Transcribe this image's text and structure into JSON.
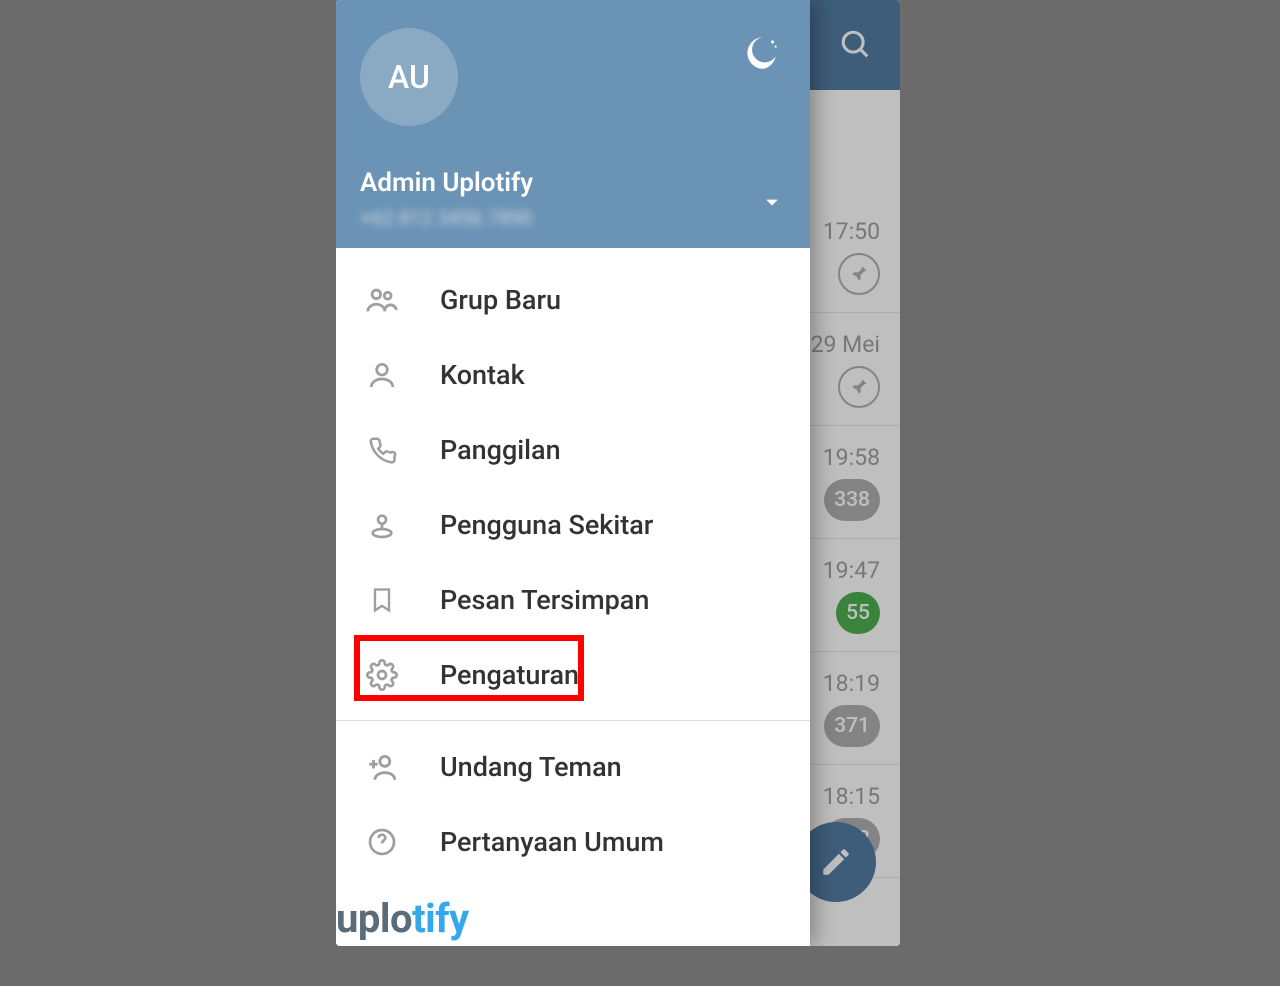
{
  "drawer": {
    "avatar_initials": "AU",
    "account_name": "Admin Uplotify",
    "account_phone": "+62 812 3456 7890",
    "menu": [
      {
        "label": "Grup Baru",
        "icon": "group-icon"
      },
      {
        "label": "Kontak",
        "icon": "person-icon"
      },
      {
        "label": "Panggilan",
        "icon": "phone-icon"
      },
      {
        "label": "Pengguna Sekitar",
        "icon": "nearby-icon"
      },
      {
        "label": "Pesan Tersimpan",
        "icon": "bookmark-icon"
      },
      {
        "label": "Pengaturan",
        "icon": "gear-icon",
        "highlighted": true
      }
    ],
    "menu2": [
      {
        "label": "Undang Teman",
        "icon": "add-person-icon"
      },
      {
        "label": "Pertanyaan Umum",
        "icon": "help-icon"
      }
    ]
  },
  "chat_list": [
    {
      "time": "17:50",
      "pinned": true
    },
    {
      "time": "29 Mei",
      "pinned": true
    },
    {
      "time": "19:58",
      "badge": "338",
      "badge_color": "gray"
    },
    {
      "time": "19:47",
      "badge": "55",
      "badge_color": "green"
    },
    {
      "time": "18:19",
      "badge": "371",
      "badge_color": "gray"
    },
    {
      "time": "18:15",
      "badge": "102",
      "badge_color": "gray"
    }
  ],
  "watermark": {
    "part1": "uplo",
    "part2": "tify"
  }
}
